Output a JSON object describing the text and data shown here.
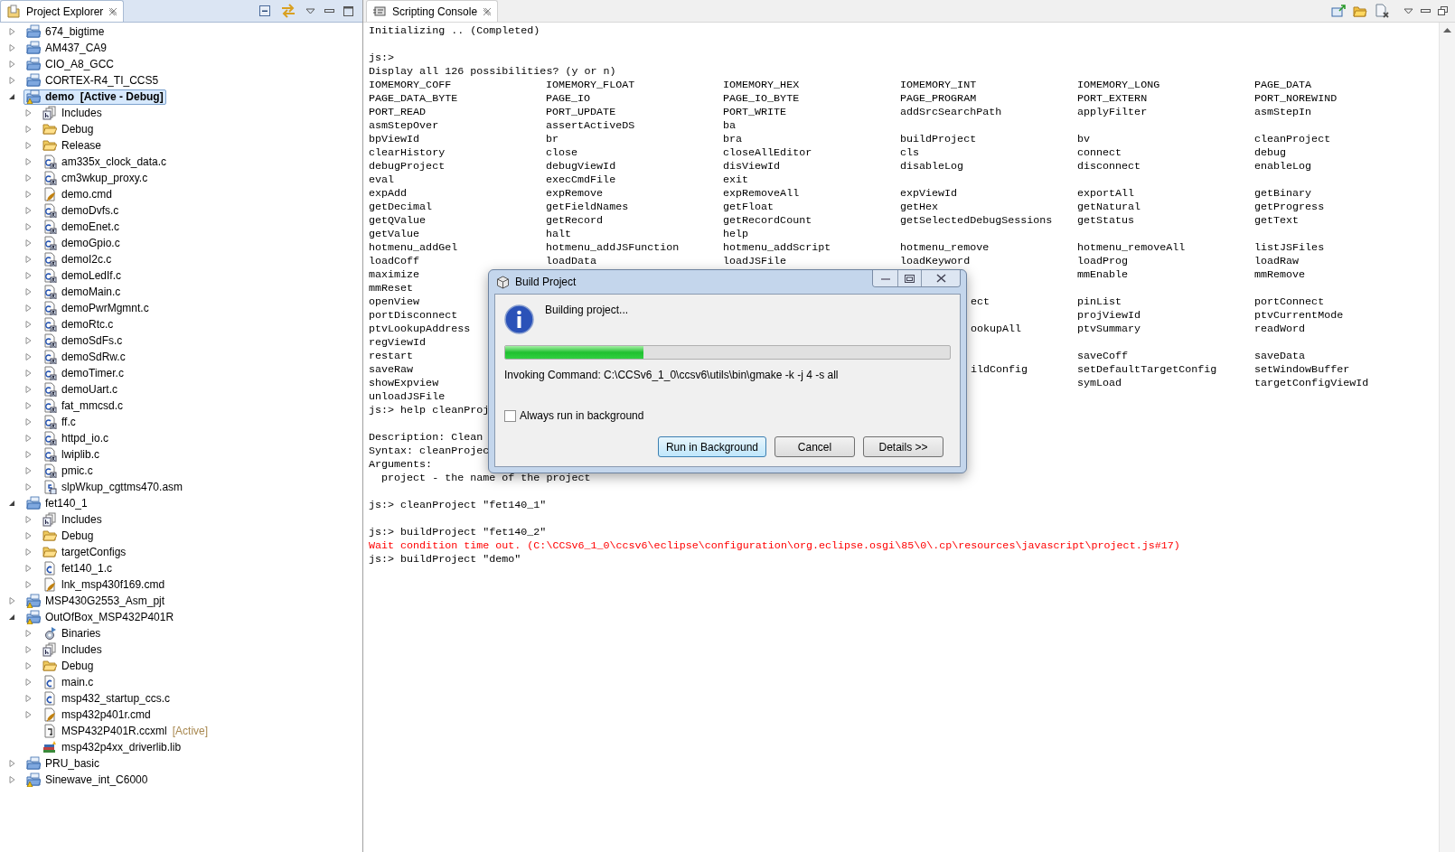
{
  "explorer": {
    "tab": {
      "label": "Project Explorer"
    },
    "items": [
      {
        "label": "674_bigtime",
        "kind": "project",
        "warning": false,
        "active": false,
        "expanded": false,
        "selected": false
      },
      {
        "label": "AM437_CA9",
        "kind": "project",
        "warning": false,
        "active": false,
        "expanded": false,
        "selected": false
      },
      {
        "label": "CIO_A8_GCC",
        "kind": "project",
        "warning": false,
        "active": false,
        "expanded": false,
        "selected": false
      },
      {
        "label": "CORTEX-R4_TI_CCS5",
        "kind": "project",
        "warning": false,
        "active": false,
        "expanded": false,
        "selected": false
      },
      {
        "label": "demo  [Active - Debug]",
        "kind": "project",
        "warning": true,
        "active": true,
        "expanded": true,
        "selected": true,
        "children": [
          {
            "label": "Includes",
            "kind": "includes",
            "expanded": false,
            "selected": false
          },
          {
            "label": "Debug",
            "kind": "folder",
            "expanded": false,
            "selected": false
          },
          {
            "label": "Release",
            "kind": "folder",
            "expanded": false,
            "selected": false
          },
          {
            "label": "am335x_clock_data.c",
            "kind": "c-source",
            "expanded": false,
            "selected": false
          },
          {
            "label": "cm3wkup_proxy.c",
            "kind": "c-source",
            "expanded": false,
            "selected": false
          },
          {
            "label": "demo.cmd",
            "kind": "cmd-file",
            "expanded": false,
            "selected": false
          },
          {
            "label": "demoDvfs.c",
            "kind": "c-source",
            "expanded": false,
            "selected": false
          },
          {
            "label": "demoEnet.c",
            "kind": "c-source",
            "expanded": false,
            "selected": false
          },
          {
            "label": "demoGpio.c",
            "kind": "c-source",
            "expanded": false,
            "selected": false
          },
          {
            "label": "demoI2c.c",
            "kind": "c-source",
            "expanded": false,
            "selected": false
          },
          {
            "label": "demoLedIf.c",
            "kind": "c-source",
            "expanded": false,
            "selected": false
          },
          {
            "label": "demoMain.c",
            "kind": "c-source",
            "expanded": false,
            "selected": false
          },
          {
            "label": "demoPwrMgmnt.c",
            "kind": "c-source",
            "expanded": false,
            "selected": false
          },
          {
            "label": "demoRtc.c",
            "kind": "c-source",
            "expanded": false,
            "selected": false
          },
          {
            "label": "demoSdFs.c",
            "kind": "c-source",
            "expanded": false,
            "selected": false
          },
          {
            "label": "demoSdRw.c",
            "kind": "c-source",
            "expanded": false,
            "selected": false
          },
          {
            "label": "demoTimer.c",
            "kind": "c-source",
            "expanded": false,
            "selected": false
          },
          {
            "label": "demoUart.c",
            "kind": "c-source",
            "expanded": false,
            "selected": false
          },
          {
            "label": "fat_mmcsd.c",
            "kind": "c-source",
            "expanded": false,
            "selected": false
          },
          {
            "label": "ff.c",
            "kind": "c-source",
            "expanded": false,
            "selected": false
          },
          {
            "label": "httpd_io.c",
            "kind": "c-source",
            "expanded": false,
            "selected": false
          },
          {
            "label": "lwiplib.c",
            "kind": "c-source",
            "expanded": false,
            "selected": false
          },
          {
            "label": "pmic.c",
            "kind": "c-source",
            "expanded": false,
            "selected": false
          },
          {
            "label": "slpWkup_cgttms470.asm",
            "kind": "asm-source",
            "expanded": false,
            "selected": false
          }
        ]
      },
      {
        "label": "fet140_1",
        "kind": "project",
        "warning": false,
        "active": false,
        "expanded": true,
        "selected": false,
        "children": [
          {
            "label": "Includes",
            "kind": "includes",
            "expanded": false,
            "selected": false
          },
          {
            "label": "Debug",
            "kind": "folder",
            "expanded": false,
            "selected": false
          },
          {
            "label": "targetConfigs",
            "kind": "folder",
            "expanded": false,
            "selected": false
          },
          {
            "label": "fet140_1.c",
            "kind": "c-file",
            "expanded": false,
            "selected": false
          },
          {
            "label": "lnk_msp430f169.cmd",
            "kind": "cmd-file",
            "expanded": false,
            "selected": false
          }
        ]
      },
      {
        "label": "MSP430G2553_Asm_pjt",
        "kind": "project",
        "warning": true,
        "active": false,
        "expanded": false,
        "selected": false
      },
      {
        "label": "OutOfBox_MSP432P401R",
        "kind": "project",
        "warning": true,
        "active": false,
        "expanded": true,
        "selected": false,
        "children": [
          {
            "label": "Binaries",
            "kind": "binaries",
            "expanded": false,
            "selected": false
          },
          {
            "label": "Includes",
            "kind": "includes",
            "expanded": false,
            "selected": false
          },
          {
            "label": "Debug",
            "kind": "folder",
            "expanded": false,
            "selected": false
          },
          {
            "label": "main.c",
            "kind": "c-file",
            "expanded": false,
            "selected": false
          },
          {
            "label": "msp432_startup_ccs.c",
            "kind": "c-file",
            "expanded": false,
            "selected": false
          },
          {
            "label": "msp432p401r.cmd",
            "kind": "cmd-file",
            "expanded": false,
            "selected": false
          },
          {
            "label": "MSP432P401R.ccxml",
            "kind": "ccxml",
            "suffix": "[Active]",
            "selected": false
          },
          {
            "label": "msp432p4xx_driverlib.lib",
            "kind": "library",
            "selected": false
          }
        ]
      },
      {
        "label": "PRU_basic",
        "kind": "project",
        "warning": false,
        "active": false,
        "expanded": false,
        "selected": false
      },
      {
        "label": "Sinewave_int_C6000",
        "kind": "project",
        "warning": true,
        "active": false,
        "expanded": false,
        "selected": false
      }
    ]
  },
  "console": {
    "tab": {
      "label": "Scripting Console"
    },
    "lines": [
      {
        "kind": "text",
        "text": "Initializing .. (Completed)"
      },
      {
        "kind": "blank"
      },
      {
        "kind": "text",
        "text": "js:>"
      },
      {
        "kind": "text",
        "text": "Display all 126 possibilities? (y or n)"
      },
      {
        "kind": "grid",
        "cells": [
          "IOMEMORY_COFF",
          "IOMEMORY_FLOAT",
          "IOMEMORY_HEX",
          "IOMEMORY_INT",
          "IOMEMORY_LONG",
          "PAGE_DATA"
        ]
      },
      {
        "kind": "grid",
        "cells": [
          "PAGE_DATA_BYTE",
          "PAGE_IO",
          "PAGE_IO_BYTE",
          "PAGE_PROGRAM",
          "PORT_EXTERN",
          "PORT_NOREWIND"
        ]
      },
      {
        "kind": "grid",
        "cells": [
          "PORT_READ",
          "PORT_UPDATE",
          "PORT_WRITE",
          "addSrcSearchPath",
          "applyFilter",
          "asmStepIn"
        ]
      },
      {
        "kind": "grid",
        "cells": [
          "asmStepOver",
          "assertActiveDS",
          "ba",
          null,
          null,
          null
        ]
      },
      {
        "kind": "grid",
        "cells": [
          "bpViewId",
          "br",
          "bra",
          "buildProject",
          "bv",
          "cleanProject"
        ]
      },
      {
        "kind": "grid",
        "cells": [
          "clearHistory",
          "close",
          "closeAllEditor",
          "cls",
          "connect",
          "debug"
        ]
      },
      {
        "kind": "grid",
        "cells": [
          "debugProject",
          "debugViewId",
          "disViewId",
          "disableLog",
          "disconnect",
          "enableLog"
        ]
      },
      {
        "kind": "grid",
        "cells": [
          "eval",
          "execCmdFile",
          "exit",
          null,
          null,
          null
        ]
      },
      {
        "kind": "grid",
        "cells": [
          "expAdd",
          "expRemove",
          "expRemoveAll",
          "expViewId",
          "exportAll",
          "getBinary"
        ]
      },
      {
        "kind": "grid",
        "cells": [
          "getDecimal",
          "getFieldNames",
          "getFloat",
          "getHex",
          "getNatural",
          "getProgress"
        ]
      },
      {
        "kind": "grid",
        "cells": [
          "getQValue",
          "getRecord",
          "getRecordCount",
          "getSelectedDebugSessions",
          "getStatus",
          "getText"
        ]
      },
      {
        "kind": "grid",
        "cells": [
          "getValue",
          "halt",
          "help",
          null,
          null,
          null
        ]
      },
      {
        "kind": "grid",
        "cells": [
          "hotmenu_addGel",
          "hotmenu_addJSFunction",
          "hotmenu_addScript",
          "hotmenu_remove",
          "hotmenu_removeAll",
          "listJSFiles"
        ]
      },
      {
        "kind": "grid",
        "cells": [
          "loadCoff",
          "loadData",
          "loadJSFile",
          "loadKeyword",
          "loadProg",
          "loadRaw"
        ]
      },
      {
        "kind": "grid",
        "cells": [
          "maximize",
          null,
          null,
          null,
          "mmEnable",
          "mmRemove"
        ]
      },
      {
        "kind": "grid",
        "cells": [
          "mmReset",
          null,
          null,
          null,
          null,
          null
        ]
      },
      {
        "kind": "grid",
        "cells": [
          "openView",
          null,
          null,
          {
            "text": "ect",
            "clipped": true
          },
          "pinList",
          "portConnect"
        ]
      },
      {
        "kind": "grid",
        "cells": [
          "portDisconnect",
          null,
          null,
          null,
          "projViewId",
          "ptvCurrentMode"
        ]
      },
      {
        "kind": "grid",
        "cells": [
          "ptvLookupAddress",
          null,
          null,
          {
            "text": "ookupAll",
            "clipped": true
          },
          "ptvSummary",
          "readWord"
        ]
      },
      {
        "kind": "grid",
        "cells": [
          "regViewId",
          null,
          null,
          null,
          null,
          null
        ]
      },
      {
        "kind": "grid",
        "cells": [
          "restart",
          null,
          null,
          null,
          "saveCoff",
          "saveData"
        ]
      },
      {
        "kind": "grid",
        "cells": [
          "saveRaw",
          null,
          null,
          {
            "text": "ildConfig",
            "clipped": true
          },
          "setDefaultTargetConfig",
          "setWindowBuffer"
        ]
      },
      {
        "kind": "grid",
        "cells": [
          "showExpview",
          null,
          null,
          null,
          "symLoad",
          "targetConfigViewId"
        ]
      },
      {
        "kind": "grid",
        "cells": [
          "unloadJSFile",
          null,
          null,
          null,
          null,
          null
        ]
      },
      {
        "kind": "text",
        "text": "js:> help cleanProj"
      },
      {
        "kind": "blank"
      },
      {
        "kind": "text",
        "text": "Description: Clean"
      },
      {
        "kind": "text",
        "text": "Syntax: cleanProjec"
      },
      {
        "kind": "text",
        "text": "Arguments:"
      },
      {
        "kind": "text",
        "text": "  project - the name of the project"
      },
      {
        "kind": "blank"
      },
      {
        "kind": "text",
        "text": "js:> cleanProject \"fet140_1\""
      },
      {
        "kind": "blank"
      },
      {
        "kind": "text",
        "text": "js:> buildProject \"fet140_2\""
      },
      {
        "kind": "error",
        "text": "Wait condition time out. (C:\\CCSv6_1_0\\ccsv6\\eclipse\\configuration\\org.eclipse.osgi\\85\\0\\.cp\\resources\\javascript\\project.js#17)"
      },
      {
        "kind": "text",
        "text": "js:> buildProject \"demo\""
      }
    ]
  },
  "dialog": {
    "title": "Build Project",
    "message": "Building project...",
    "progress": {
      "level": 0.31
    },
    "command": "Invoking Command: C:\\CCSv6_1_0\\ccsv6\\utils\\bin\\gmake -k -j 4 -s all",
    "checkbox": {
      "label": "Always run in background",
      "checked": false
    },
    "buttons": [
      {
        "label": "Run in Background",
        "default": true
      },
      {
        "label": "Cancel",
        "default": false
      },
      {
        "label": "Details >>",
        "default": false
      }
    ]
  }
}
